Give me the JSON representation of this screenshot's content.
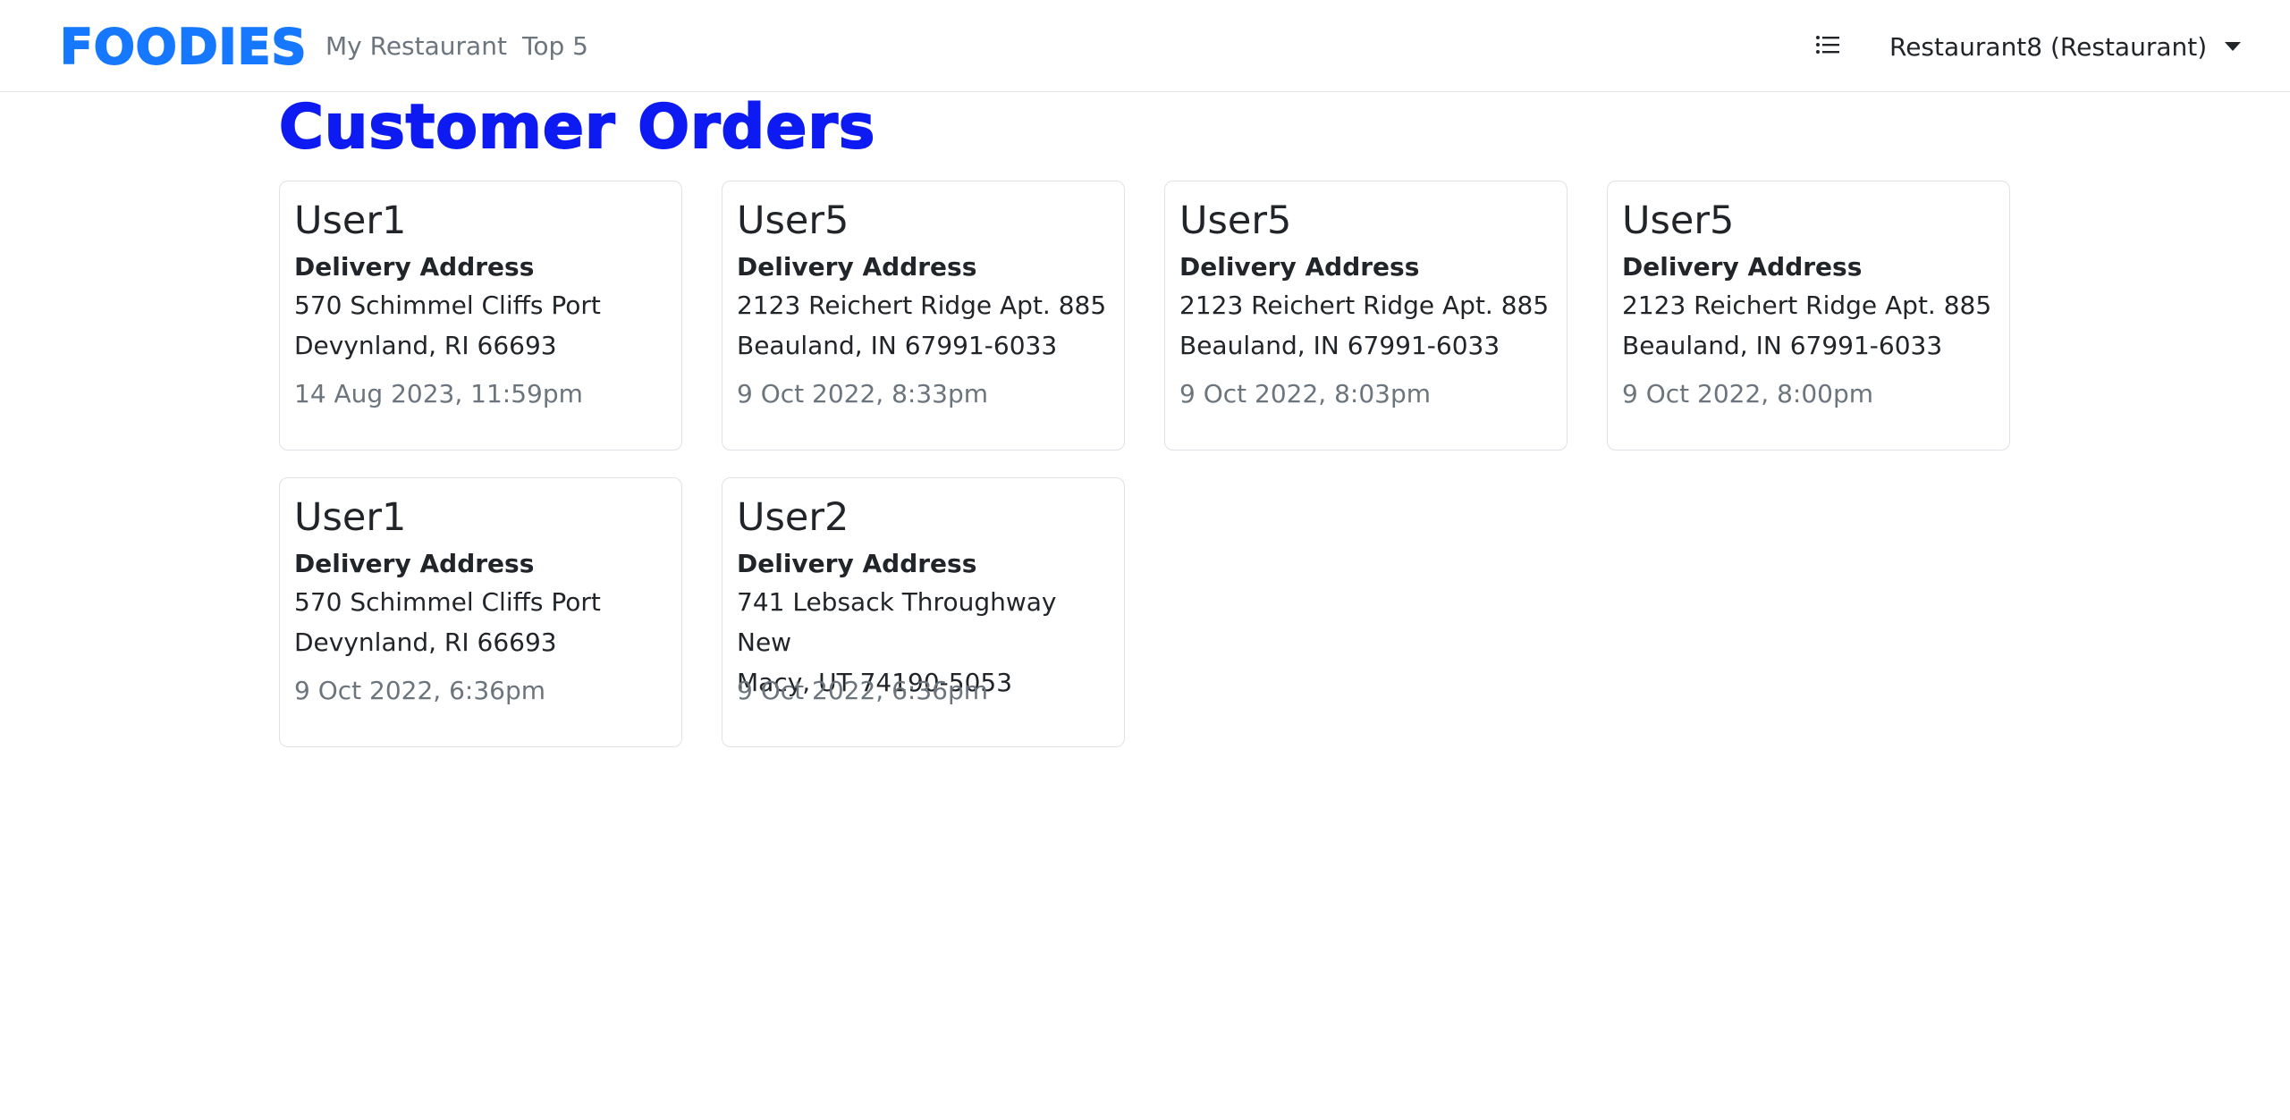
{
  "navbar": {
    "brand": "FOODIES",
    "links": [
      "My Restaurant",
      "Top 5"
    ],
    "list_icon": "list-icon",
    "user_menu": "Restaurant8 (Restaurant)",
    "brand_color": "#1677ff"
  },
  "page": {
    "title": "Customer Orders",
    "title_color": "#0d1bf2"
  },
  "orders": [
    {
      "user": "User1",
      "label": "Delivery Address",
      "address_line1": "570 Schimmel Cliffs Port",
      "address_line2": "Devynland, RI 66693",
      "date": "14 Aug 2023, 11:59pm"
    },
    {
      "user": "User5",
      "label": "Delivery Address",
      "address_line1": "2123 Reichert Ridge Apt. 885",
      "address_line2": "Beauland, IN 67991-6033",
      "date": "9 Oct 2022, 8:33pm"
    },
    {
      "user": "User5",
      "label": "Delivery Address",
      "address_line1": "2123 Reichert Ridge Apt. 885",
      "address_line2": "Beauland, IN 67991-6033",
      "date": "9 Oct 2022, 8:03pm"
    },
    {
      "user": "User5",
      "label": "Delivery Address",
      "address_line1": "2123 Reichert Ridge Apt. 885",
      "address_line2": "Beauland, IN 67991-6033",
      "date": "9 Oct 2022, 8:00pm"
    },
    {
      "user": "User1",
      "label": "Delivery Address",
      "address_line1": "570 Schimmel Cliffs Port",
      "address_line2": "Devynland, RI 66693",
      "date": "9 Oct 2022, 6:36pm"
    },
    {
      "user": "User2",
      "label": "Delivery Address",
      "address_line1": "741 Lebsack Throughway New",
      "address_line2": "Macy, UT 74190-5053",
      "date": "9 Oct 2022, 6:36pm"
    }
  ]
}
